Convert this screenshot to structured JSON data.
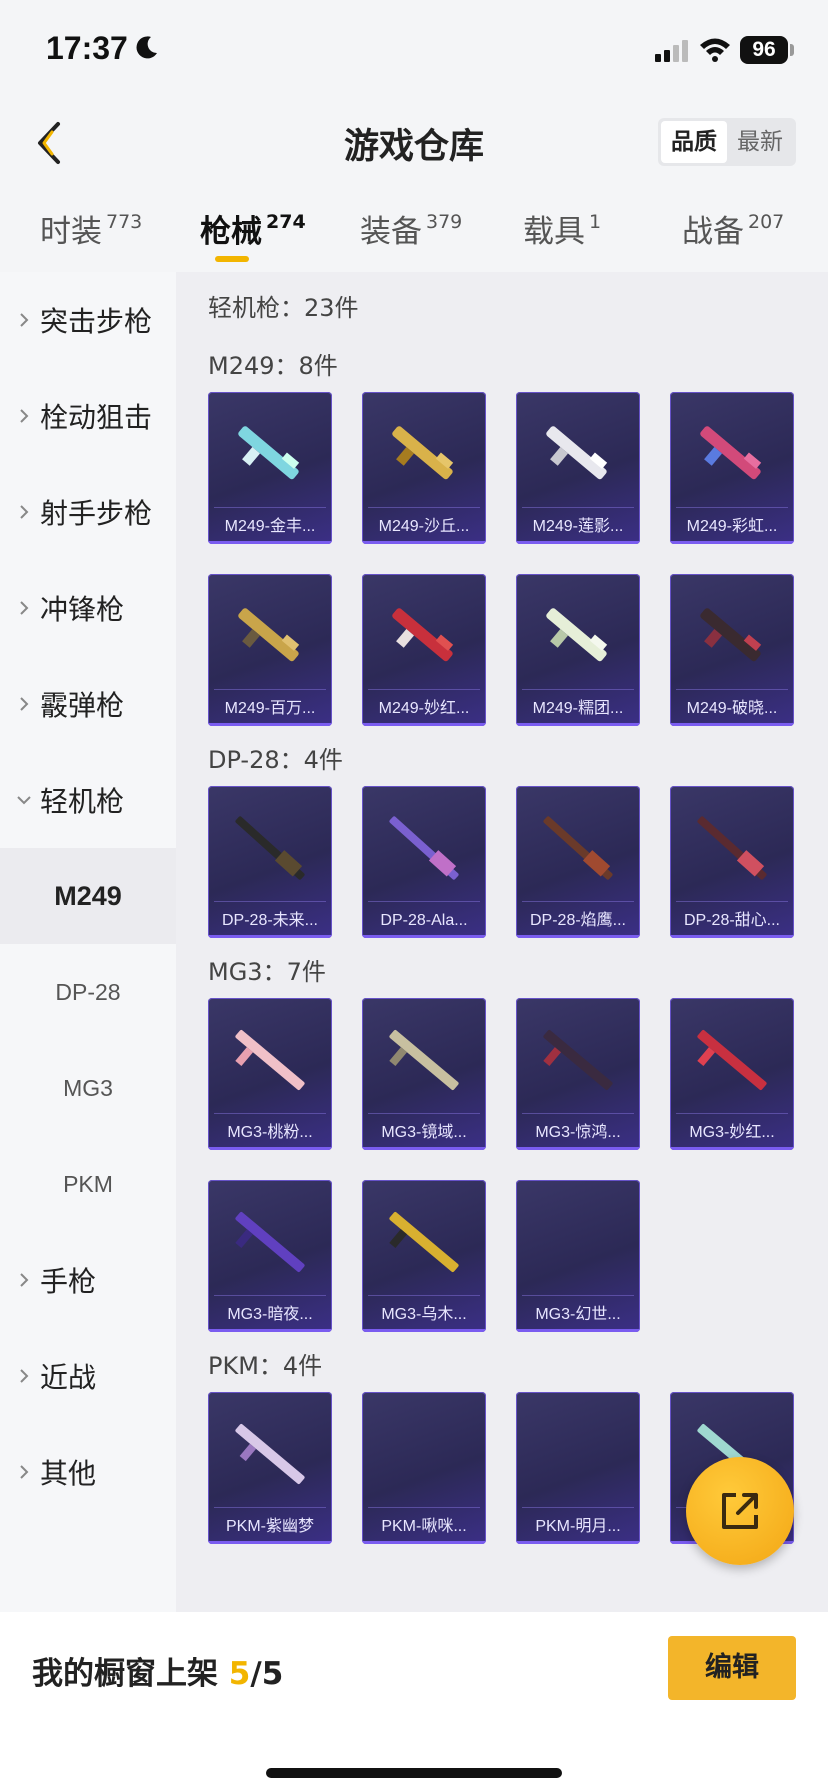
{
  "status_bar": {
    "time": "17:37",
    "battery": "96"
  },
  "header": {
    "title": "游戏仓库",
    "sort": [
      "品质",
      "最新"
    ]
  },
  "tabs": [
    {
      "label": "时装",
      "count": "773"
    },
    {
      "label": "枪械",
      "count": "274"
    },
    {
      "label": "装备",
      "count": "379"
    },
    {
      "label": "载具",
      "count": "1"
    },
    {
      "label": "战备",
      "count": "207"
    }
  ],
  "sidebar": {
    "groups": [
      "突击步枪",
      "栓动狙击",
      "射手步枪",
      "冲锋枪",
      "霰弹枪",
      "轻机枪"
    ],
    "sub": [
      "M249",
      "DP-28",
      "MG3",
      "PKM"
    ],
    "after": [
      "手枪",
      "近战",
      "其他"
    ]
  },
  "main": {
    "summary": "轻机枪：23件",
    "sections": [
      {
        "title": "M249：8件",
        "items": [
          "M249-金丰...",
          "M249-沙丘...",
          "M249-莲影...",
          "M249-彩虹...",
          "M249-百万...",
          "M249-妙红...",
          "M249-糯团...",
          "M249-破晓..."
        ]
      },
      {
        "title": "DP-28：4件",
        "items": [
          "DP-28-未来...",
          "DP-28-Ala...",
          "DP-28-焰鹰...",
          "DP-28-甜心..."
        ]
      },
      {
        "title": "MG3：7件",
        "items": [
          "MG3-桃粉...",
          "MG3-镜域...",
          "MG3-惊鸿...",
          "MG3-妙红...",
          "MG3-暗夜...",
          "MG3-乌木...",
          "MG3-幻世..."
        ]
      },
      {
        "title": "PKM：4件",
        "items": [
          "PKM-紫幽梦",
          "PKM-啾咪...",
          "PKM-明月...",
          ""
        ]
      }
    ]
  },
  "bottom": {
    "shelf_label": "我的橱窗上架 ",
    "shelf_count": "5",
    "shelf_total": "/5",
    "edit": "编辑"
  },
  "colors": {
    "accent": "#f2b500",
    "card_bg": "#2c2956",
    "card_border": "#6652c8"
  }
}
